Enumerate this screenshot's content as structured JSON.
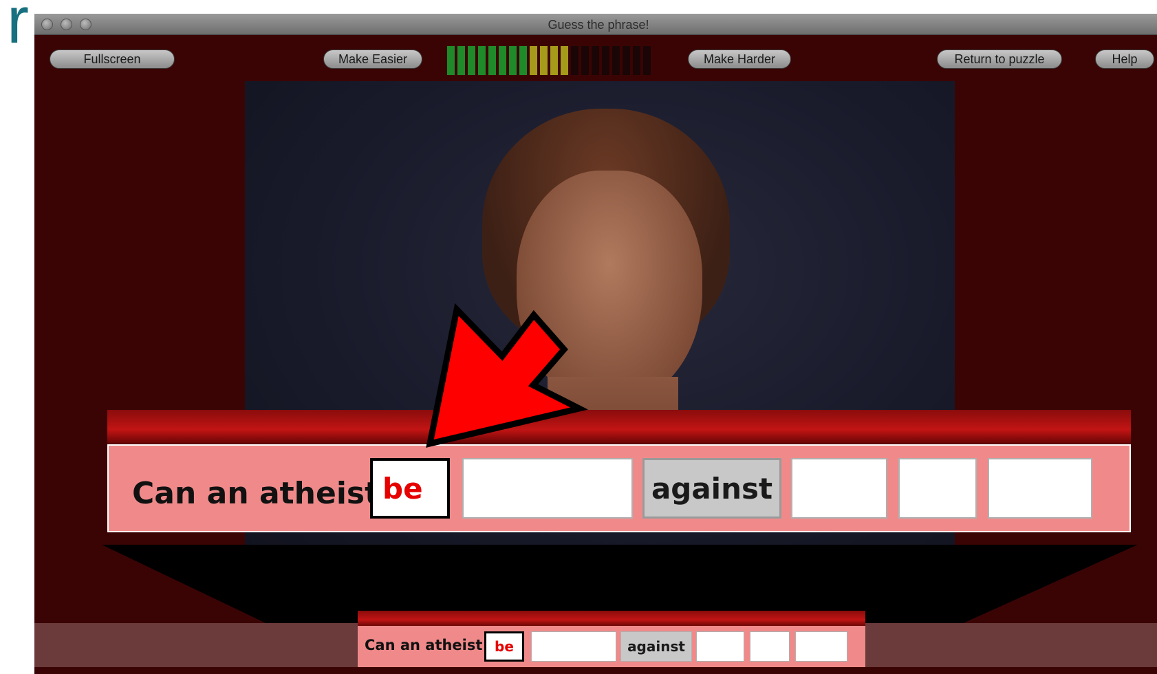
{
  "slide": {
    "fragment_text": "r"
  },
  "window": {
    "title": "Guess the phrase!",
    "buttons": {
      "fullscreen": "Fullscreen",
      "make_easier": "Make Easier",
      "make_harder": "Make Harder",
      "return_to_puzzle": "Return to puzzle",
      "help": "Help"
    },
    "difficulty_meter": {
      "total_segments": 20,
      "lit_segments": 12,
      "colors": {
        "lit_green": "#1f8a2a",
        "lit_yellow": "#a69a1a",
        "unlit": "#1a0606"
      }
    }
  },
  "puzzle": {
    "prefix": "Can an atheist",
    "slots": [
      {
        "text": "be",
        "state": "active"
      },
      {
        "text": "",
        "state": "empty"
      },
      {
        "text": "against",
        "state": "given"
      },
      {
        "text": "",
        "state": "empty"
      },
      {
        "text": "",
        "state": "empty"
      },
      {
        "text": "",
        "state": "empty"
      }
    ]
  },
  "annotation": {
    "arrow_color": "#ff0000",
    "arrow_icon": "arrow-pointing-down-left"
  },
  "colors": {
    "window_bg": "#3b0404",
    "band_bg": "#f08a8a",
    "active_text": "#e60000"
  }
}
